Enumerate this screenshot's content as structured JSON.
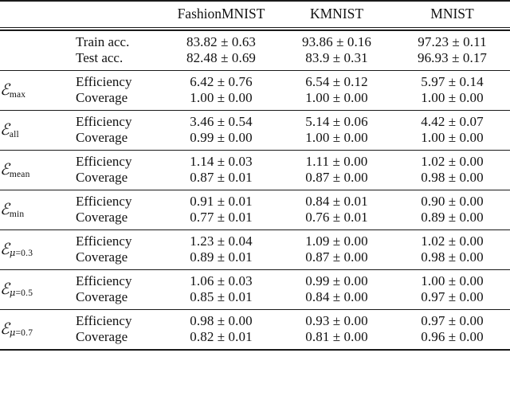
{
  "table": {
    "columns": [
      "",
      "",
      "FashionMNIST",
      "KMNIST",
      "MNIST"
    ],
    "datasets": [
      "FashionMNIST",
      "KMNIST",
      "MNIST"
    ],
    "plusminus": "±",
    "script_e": "ℰ",
    "blocks": [
      {
        "symbol": "",
        "symbol_sub": "",
        "rows": [
          {
            "metric": "Train acc.",
            "values": [
              "83.82 ± 0.63",
              "93.86 ± 0.16",
              "97.23 ± 0.11"
            ]
          },
          {
            "metric": "Test acc.",
            "values": [
              "82.48 ± 0.69",
              "83.9 ± 0.31",
              "96.93 ± 0.17"
            ]
          }
        ]
      },
      {
        "symbol": "ℰ",
        "symbol_sub": "max",
        "rows": [
          {
            "metric": "Efficiency",
            "values": [
              "6.42 ± 0.76",
              "6.54 ± 0.12",
              "5.97 ± 0.14"
            ]
          },
          {
            "metric": "Coverage",
            "values": [
              "1.00 ± 0.00",
              "1.00 ± 0.00",
              "1.00 ± 0.00"
            ]
          }
        ]
      },
      {
        "symbol": "ℰ",
        "symbol_sub": "all",
        "rows": [
          {
            "metric": "Efficiency",
            "values": [
              "3.46 ± 0.54",
              "5.14 ± 0.06",
              "4.42 ± 0.07"
            ]
          },
          {
            "metric": "Coverage",
            "values": [
              "0.99 ± 0.00",
              "1.00 ± 0.00",
              "1.00 ± 0.00"
            ]
          }
        ]
      },
      {
        "symbol": "ℰ",
        "symbol_sub": "mean",
        "rows": [
          {
            "metric": "Efficiency",
            "values": [
              "1.14 ± 0.03",
              "1.11 ± 0.00",
              "1.02 ± 0.00"
            ]
          },
          {
            "metric": "Coverage",
            "values": [
              "0.87 ± 0.01",
              "0.87 ± 0.00",
              "0.98 ± 0.00"
            ]
          }
        ]
      },
      {
        "symbol": "ℰ",
        "symbol_sub": "min",
        "rows": [
          {
            "metric": "Efficiency",
            "values": [
              "0.91 ± 0.01",
              "0.84 ± 0.01",
              "0.90 ± 0.00"
            ]
          },
          {
            "metric": "Coverage",
            "values": [
              "0.77 ± 0.01",
              "0.76 ± 0.01",
              "0.89 ± 0.00"
            ]
          }
        ]
      },
      {
        "symbol": "ℰ",
        "symbol_sub": "μ=0.3",
        "rows": [
          {
            "metric": "Efficiency",
            "values": [
              "1.23 ± 0.04",
              "1.09 ± 0.00",
              "1.02 ± 0.00"
            ]
          },
          {
            "metric": "Coverage",
            "values": [
              "0.89 ± 0.01",
              "0.87 ± 0.00",
              "0.98 ± 0.00"
            ]
          }
        ]
      },
      {
        "symbol": "ℰ",
        "symbol_sub": "μ=0.5",
        "rows": [
          {
            "metric": "Efficiency",
            "values": [
              "1.06 ± 0.03",
              "0.99 ± 0.00",
              "1.00 ± 0.00"
            ]
          },
          {
            "metric": "Coverage",
            "values": [
              "0.85 ± 0.01",
              "0.84 ± 0.00",
              "0.97 ± 0.00"
            ]
          }
        ]
      },
      {
        "symbol": "ℰ",
        "symbol_sub": "μ=0.7",
        "rows": [
          {
            "metric": "Efficiency",
            "values": [
              "0.98 ± 0.00",
              "0.93 ± 0.00",
              "0.97 ± 0.00"
            ]
          },
          {
            "metric": "Coverage",
            "values": [
              "0.82 ± 0.01",
              "0.81 ± 0.00",
              "0.96 ± 0.00"
            ]
          }
        ]
      }
    ]
  }
}
